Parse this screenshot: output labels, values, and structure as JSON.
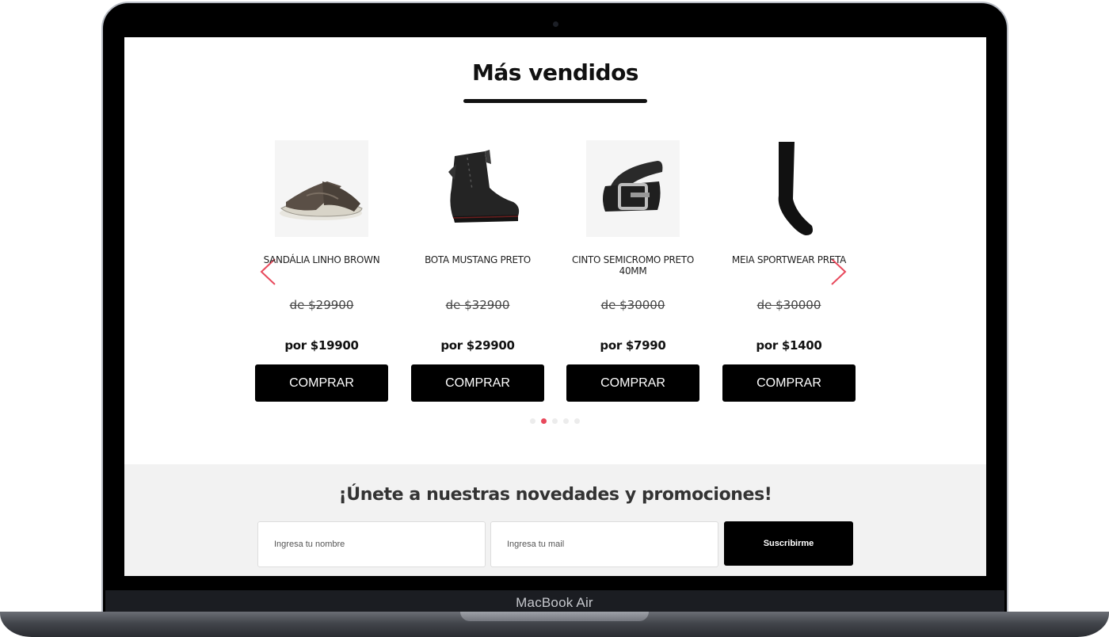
{
  "device": {
    "brand_label": "MacBook Air"
  },
  "section": {
    "title": "Más vendidos"
  },
  "carousel": {
    "prev_icon": "chevron-left-icon",
    "next_icon": "chevron-right-icon",
    "accent_color": "#e8495c",
    "active_dot": 2,
    "dot_count": 5
  },
  "products": [
    {
      "name": "SANDÁLIA LINHO BROWN",
      "old_price": "de $29900",
      "new_price": "por $19900",
      "button": "COMPRAR",
      "icon": "sandal-icon"
    },
    {
      "name": "BOTA MUSTANG PRETO",
      "old_price": "de $32900",
      "new_price": "por $29900",
      "button": "COMPRAR",
      "icon": "boot-icon"
    },
    {
      "name": "CINTO SEMICROMO PRETO 40MM",
      "old_price": "de $30000",
      "new_price": "por $7990",
      "button": "COMPRAR",
      "icon": "belt-icon"
    },
    {
      "name": "MEIA SPORTWEAR PRETA",
      "old_price": "de $30000",
      "new_price": "por $1400",
      "button": "COMPRAR",
      "icon": "sock-icon"
    }
  ],
  "newsletter": {
    "title": "¡Únete a nuestras novedades y promociones!",
    "name_placeholder": "Ingresa tu nombre",
    "mail_placeholder": "Ingresa tu mail",
    "submit_label": "Suscribirme"
  }
}
